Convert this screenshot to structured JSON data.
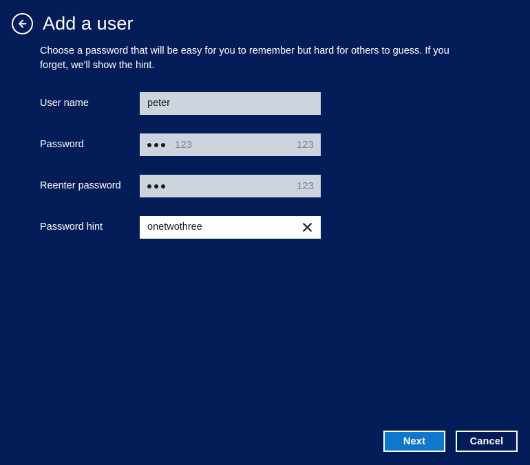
{
  "window": {
    "background_color": "#041c58"
  },
  "header": {
    "back_icon": "back-arrow-circle-icon",
    "title": "Add a user"
  },
  "description": "Choose a password that will be easy for you to remember but hard for others to guess. If you forget, we'll show the hint.",
  "form": {
    "fields": [
      {
        "label": "User name",
        "value": "peter",
        "type": "text",
        "focused": false
      },
      {
        "label": "Password",
        "value": "•••",
        "masked": true,
        "dot_count": 3,
        "ghost_text": "123",
        "ghost_text_right": "123",
        "type": "password",
        "focused": false
      },
      {
        "label": "Reenter password",
        "value": "•••",
        "masked": true,
        "dot_count": 3,
        "ghost_text_right": "123",
        "type": "password",
        "focused": false
      },
      {
        "label": "Password hint",
        "value": "onetwothree",
        "type": "text",
        "focused": true,
        "clear_icon": "clear-x-icon"
      }
    ]
  },
  "footer": {
    "next_label": "Next",
    "cancel_label": "Cancel",
    "next_color": "#0f77cc"
  }
}
